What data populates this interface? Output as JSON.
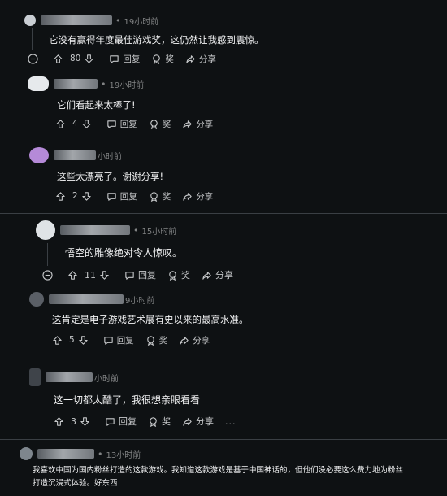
{
  "labels": {
    "reply": "回复",
    "award": "奖",
    "share": "分享",
    "more": "..."
  },
  "comments": [
    {
      "time": "19小时前",
      "text": "它没有赢得年度最佳游戏奖，这仍然让我感到震惊。",
      "votes": "80"
    },
    {
      "time": "19小时前",
      "text": "它们看起来太棒了!",
      "votes": "4"
    },
    {
      "time": "小时前",
      "text": "这些太漂亮了。谢谢分享!",
      "votes": "2"
    },
    {
      "time": "15小时前",
      "text": "悟空的雕像绝对令人惊叹。",
      "votes": "11"
    },
    {
      "time": "9小时前",
      "text": "这肯定是电子游戏艺术展有史以来的最高水准。",
      "votes": "5"
    },
    {
      "time": "小时前",
      "text": "这一切都太酷了，我很想亲眼看看",
      "votes": "3"
    },
    {
      "time": "13小时前",
      "text": "我喜欢中国为国内粉丝打造的这款游戏。我知道这款游戏是基于中国神话的，但他们没必要这么费力地为粉丝",
      "text2": "打造沉浸式体验。好东西"
    }
  ],
  "colors": {
    "background": "#0e1113",
    "text": "#f2f3f4",
    "muted": "#818384",
    "separator": "#3a3f44"
  }
}
